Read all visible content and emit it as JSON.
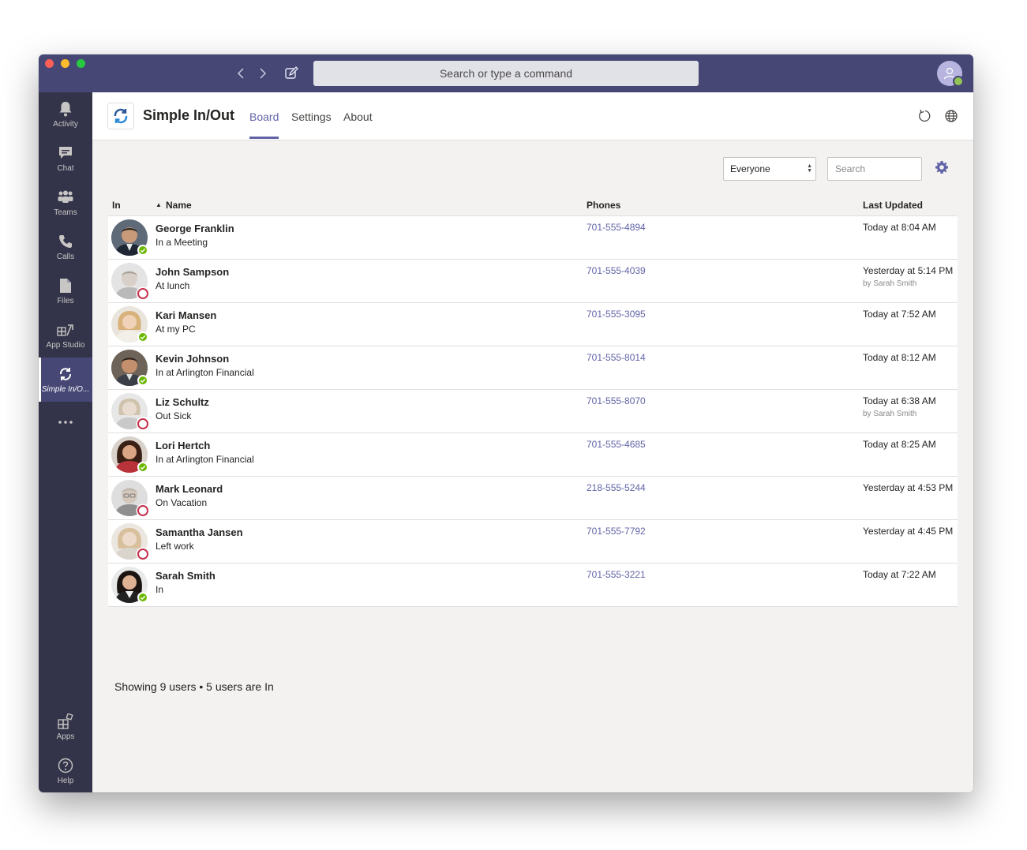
{
  "titlebar": {
    "search_placeholder": "Search or type a command"
  },
  "rail": {
    "items": [
      {
        "label": "Activity",
        "icon": "bell-icon"
      },
      {
        "label": "Chat",
        "icon": "chat-icon"
      },
      {
        "label": "Teams",
        "icon": "teams-icon"
      },
      {
        "label": "Calls",
        "icon": "phone-icon"
      },
      {
        "label": "Files",
        "icon": "file-icon"
      },
      {
        "label": "App Studio",
        "icon": "app-studio-icon"
      },
      {
        "label": "Simple In/O...",
        "icon": "simple-inout-icon"
      },
      {
        "label": "Apps",
        "icon": "apps-icon"
      },
      {
        "label": "Help",
        "icon": "help-icon"
      }
    ]
  },
  "app": {
    "name": "Simple In/Out",
    "tabs": [
      "Board",
      "Settings",
      "About"
    ],
    "active_tab": "Board"
  },
  "filters": {
    "group_selected": "Everyone",
    "search_placeholder": "Search"
  },
  "table": {
    "headers": {
      "in": "In",
      "name": "Name",
      "phones": "Phones",
      "updated": "Last Updated"
    },
    "rows": [
      {
        "name": "George Franklin",
        "status": "In a Meeting",
        "in": true,
        "phone": "701-555-4894",
        "updated": "Today at 8:04 AM",
        "by": ""
      },
      {
        "name": "John Sampson",
        "status": "At lunch",
        "in": false,
        "phone": "701-555-4039",
        "updated": "Yesterday at 5:14 PM",
        "by": "by Sarah Smith"
      },
      {
        "name": "Kari Mansen",
        "status": "At my PC",
        "in": true,
        "phone": "701-555-3095",
        "updated": "Today at 7:52 AM",
        "by": ""
      },
      {
        "name": "Kevin Johnson",
        "status": "In at Arlington Financial",
        "in": true,
        "phone": "701-555-8014",
        "updated": "Today at 8:12 AM",
        "by": ""
      },
      {
        "name": "Liz Schultz",
        "status": "Out Sick",
        "in": false,
        "phone": "701-555-8070",
        "updated": "Today at 6:38 AM",
        "by": "by Sarah Smith"
      },
      {
        "name": "Lori Hertch",
        "status": "In at Arlington Financial",
        "in": true,
        "phone": "701-555-4685",
        "updated": "Today at 8:25 AM",
        "by": ""
      },
      {
        "name": "Mark Leonard",
        "status": "On Vacation",
        "in": false,
        "phone": "218-555-5244",
        "updated": "Yesterday at 4:53 PM",
        "by": ""
      },
      {
        "name": "Samantha Jansen",
        "status": "Left work",
        "in": false,
        "phone": "701-555-7792",
        "updated": "Yesterday at 4:45 PM",
        "by": ""
      },
      {
        "name": "Sarah Smith",
        "status": "In",
        "in": true,
        "phone": "701-555-3221",
        "updated": "Today at 7:22 AM",
        "by": ""
      }
    ]
  },
  "footer": {
    "summary": "Showing 9 users • 5 users are In"
  },
  "colors": {
    "accent": "#6264a7",
    "titlebar": "#464775",
    "rail": "#33344a",
    "status_in": "#6bb700",
    "status_out": "#c4314b"
  }
}
